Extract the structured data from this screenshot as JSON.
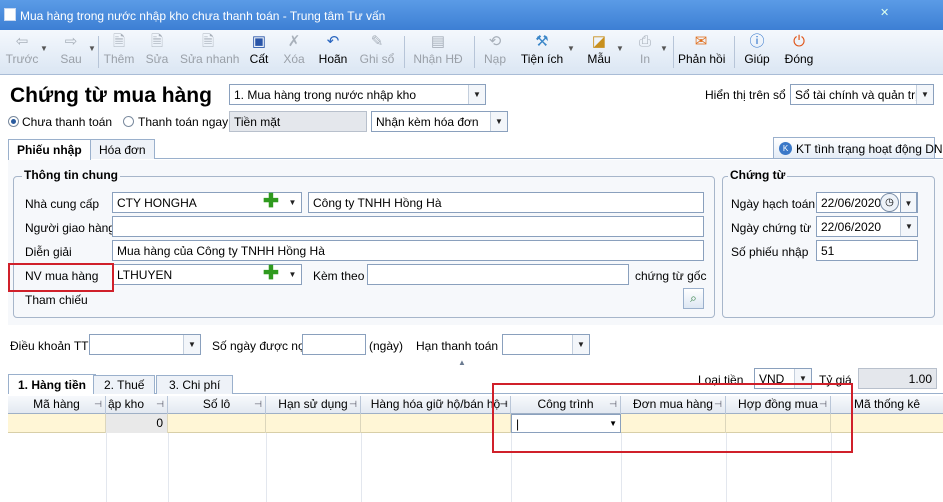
{
  "window": {
    "title": "Mua hàng trong nước nhập kho chưa thanh toán - Trung tâm Tư vấn"
  },
  "toolbar": [
    {
      "name": "truoc",
      "label": "Trước",
      "icon": "arrow-left-icon",
      "disabled": true
    },
    {
      "name": "sau",
      "label": "Sau",
      "icon": "arrow-right-icon",
      "disabled": true
    },
    {
      "name": "them",
      "label": "Thêm",
      "icon": "add-doc-icon",
      "disabled": true
    },
    {
      "name": "sua",
      "label": "Sửa",
      "icon": "edit-doc-icon",
      "disabled": true
    },
    {
      "name": "sua-nhanh",
      "label": "Sửa nhanh",
      "icon": "quick-edit-icon",
      "disabled": true
    },
    {
      "name": "cat",
      "label": "Cất",
      "icon": "save-icon",
      "disabled": false
    },
    {
      "name": "xoa",
      "label": "Xóa",
      "icon": "delete-icon",
      "disabled": true
    },
    {
      "name": "hoan",
      "label": "Hoãn",
      "icon": "undo-icon",
      "disabled": false
    },
    {
      "name": "ghi-so",
      "label": "Ghi sổ",
      "icon": "pen-icon",
      "disabled": true
    },
    {
      "name": "nhan-hd",
      "label": "Nhận HĐ",
      "icon": "receive-invoice-icon",
      "disabled": true
    },
    {
      "name": "nap",
      "label": "Nạp",
      "icon": "reload-icon",
      "disabled": true
    },
    {
      "name": "tien-ich",
      "label": "Tiện ích",
      "icon": "tools-icon",
      "disabled": false
    },
    {
      "name": "mau",
      "label": "Mẫu",
      "icon": "template-icon",
      "disabled": false
    },
    {
      "name": "in",
      "label": "In",
      "icon": "printer-icon",
      "disabled": true
    },
    {
      "name": "phan-hoi",
      "label": "Phản hồi",
      "icon": "mail-icon",
      "disabled": false
    },
    {
      "name": "giup",
      "label": "Giúp",
      "icon": "help-icon",
      "disabled": false
    },
    {
      "name": "dong",
      "label": "Đóng",
      "icon": "close-icon",
      "disabled": false
    }
  ],
  "header": {
    "title": "Chứng từ mua hàng",
    "type_select": "1. Mua hàng trong nước nhập kho",
    "display_label": "Hiển thị trên sổ",
    "display_select": "Sổ tài chính và quản trị",
    "radio_unpaid": "Chưa thanh toán",
    "radio_paid": "Thanh toán ngay",
    "cash_field": "Tiền mặt",
    "invoice_select": "Nhận kèm hóa đơn"
  },
  "tabs": {
    "phieu_nhap": "Phiếu nhập",
    "hoa_don": "Hóa đơn",
    "kt_button": "KT tình trạng hoạt động DN"
  },
  "thong_tin_chung": {
    "title": "Thông tin chung",
    "nha_cung_cap_label": "Nhà cung cấp",
    "nha_cung_cap_code": "CTY HONGHA",
    "nha_cung_cap_name": "Công ty TNHH Hồng Hà",
    "nguoi_giao_hang_label": "Người giao hàng",
    "nguoi_giao_hang": "",
    "dien_giai_label": "Diễn giải",
    "dien_giai": "Mua hàng của Công ty TNHH Hồng Hà",
    "nv_mua_hang_label": "NV mua hàng",
    "nv_mua_hang": "LTHUYEN",
    "kem_theo_label": "Kèm theo",
    "kem_theo": "",
    "chung_tu_goc": "chứng từ gốc",
    "tham_chieu_label": "Tham chiếu"
  },
  "chung_tu": {
    "title": "Chứng từ",
    "ngay_hach_toan_label": "Ngày hạch toán",
    "ngay_hach_toan": "22/06/2020",
    "ngay_chung_tu_label": "Ngày chứng từ",
    "ngay_chung_tu": "22/06/2020",
    "so_phieu_nhap_label": "Số phiếu nhập",
    "so_phieu_nhap": "51"
  },
  "payment": {
    "dieu_khoan_label": "Điều khoản TT",
    "so_ngay_label": "Số ngày được nợ",
    "ngay_unit": "(ngày)",
    "han_thanh_toan_label": "Hạn thanh toán"
  },
  "detail_tabs": {
    "hang_tien": "1. Hàng tiền",
    "thue": "2. Thuế",
    "chi_phi": "3. Chi phí"
  },
  "currency": {
    "loai_tien_label": "Loại tiền",
    "loai_tien": "VND",
    "ty_gia_label": "Tỷ giá",
    "ty_gia": "1.00"
  },
  "grid": {
    "columns": [
      "Mã hàng",
      "ập kho",
      "Số lô",
      "Hạn sử dụng",
      "Hàng hóa giữ hộ/bán hộ",
      "Công trình",
      "Đơn mua hàng",
      "Hợp đồng mua",
      "Mã thống kê"
    ],
    "row": {
      "ma_hang": "",
      "so_luong": "0",
      "so_lo": "",
      "han_su_dung": "",
      "hang_hoa": "",
      "cong_trinh": "|",
      "don_mua_hang": "",
      "hop_dong_mua": "",
      "ma_thong_ke": ""
    }
  },
  "colors": {
    "title_bar": "#4a8cdb",
    "highlight_row": "#fff6d6",
    "red_annotation": "#d0202a"
  }
}
